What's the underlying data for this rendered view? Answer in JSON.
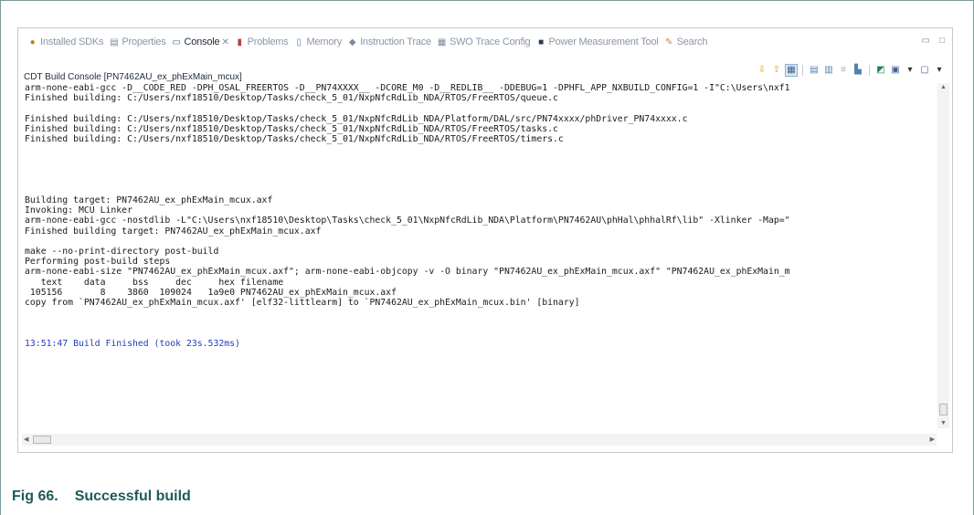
{
  "tabs": [
    {
      "label": "Installed SDKs",
      "icon": "sdk-icon",
      "active": false
    },
    {
      "label": "Properties",
      "icon": "properties-icon",
      "active": false
    },
    {
      "label": "Console",
      "icon": "console-icon",
      "active": true,
      "close": "✕"
    },
    {
      "label": "Problems",
      "icon": "problems-icon",
      "active": false
    },
    {
      "label": "Memory",
      "icon": "memory-icon",
      "active": false
    },
    {
      "label": "Instruction Trace",
      "icon": "trace-icon",
      "active": false
    },
    {
      "label": "SWO Trace Config",
      "icon": "swo-icon",
      "active": false
    },
    {
      "label": "Power Measurement Tool",
      "icon": "power-icon",
      "active": false
    },
    {
      "label": "Search",
      "icon": "search-icon",
      "active": false
    }
  ],
  "window_controls": {
    "minimize": "▭",
    "maximize": "□"
  },
  "console_title": "CDT Build Console [PN7462AU_ex_phExMain_mcux]",
  "console_lines": [
    {
      "text": "arm-none-eabi-gcc -D__CODE_RED -DPH_OSAL_FREERTOS -D__PN74XXXX__ -DCORE_M0 -D__REDLIB__ -DDEBUG=1 -DPHFL_APP_NXBUILD_CONFIG=1 -I\"C:\\Users\\nxf1",
      "color": "default"
    },
    {
      "text": "Finished building: C:/Users/nxf18510/Desktop/Tasks/check_5_01/NxpNfcRdLib_NDA/RTOS/FreeRTOS/queue.c",
      "color": "default"
    },
    {
      "text": "",
      "color": "default"
    },
    {
      "text": "Finished building: C:/Users/nxf18510/Desktop/Tasks/check_5_01/NxpNfcRdLib_NDA/Platform/DAL/src/PN74xxxx/phDriver_PN74xxxx.c",
      "color": "default"
    },
    {
      "text": "Finished building: C:/Users/nxf18510/Desktop/Tasks/check_5_01/NxpNfcRdLib_NDA/RTOS/FreeRTOS/tasks.c",
      "color": "default"
    },
    {
      "text": "Finished building: C:/Users/nxf18510/Desktop/Tasks/check_5_01/NxpNfcRdLib_NDA/RTOS/FreeRTOS/timers.c",
      "color": "default"
    },
    {
      "text": "",
      "color": "default"
    },
    {
      "text": "",
      "color": "default"
    },
    {
      "text": "",
      "color": "default"
    },
    {
      "text": "",
      "color": "default"
    },
    {
      "text": "",
      "color": "default"
    },
    {
      "text": "Building target: PN7462AU_ex_phExMain_mcux.axf",
      "color": "default"
    },
    {
      "text": "Invoking: MCU Linker",
      "color": "default"
    },
    {
      "text": "arm-none-eabi-gcc -nostdlib -L\"C:\\Users\\nxf18510\\Desktop\\Tasks\\check_5_01\\NxpNfcRdLib_NDA\\Platform\\PN7462AU\\phHal\\phhalRf\\lib\" -Xlinker -Map=\"",
      "color": "default"
    },
    {
      "text": "Finished building target: PN7462AU_ex_phExMain_mcux.axf",
      "color": "default"
    },
    {
      "text": "",
      "color": "default"
    },
    {
      "text": "make --no-print-directory post-build",
      "color": "default"
    },
    {
      "text": "Performing post-build steps",
      "color": "default"
    },
    {
      "text": "arm-none-eabi-size \"PN7462AU_ex_phExMain_mcux.axf\"; arm-none-eabi-objcopy -v -O binary \"PN7462AU_ex_phExMain_mcux.axf\" \"PN7462AU_ex_phExMain_m",
      "color": "default"
    },
    {
      "text": "   text    data     bss     dec     hex filename",
      "color": "default"
    },
    {
      "text": " 105156       8    3860  109024   1a9e0 PN7462AU_ex_phExMain_mcux.axf",
      "color": "default"
    },
    {
      "text": "copy from `PN7462AU_ex_phExMain_mcux.axf' [elf32-littlearm] to `PN7462AU_ex_phExMain_mcux.bin' [binary]",
      "color": "default"
    },
    {
      "text": "",
      "color": "default"
    },
    {
      "text": "",
      "color": "default"
    },
    {
      "text": "",
      "color": "default"
    },
    {
      "text": "13:51:47 Build Finished (took 23s.532ms)",
      "color": "blue"
    }
  ],
  "colors": {
    "panel_border": "#c4c9d2",
    "console_text": "#1a1a1a",
    "console_finished": "#1f3fbf",
    "caption": "#1f5a5a"
  },
  "caption": {
    "number": "Fig 66.",
    "title": "Successful build"
  }
}
